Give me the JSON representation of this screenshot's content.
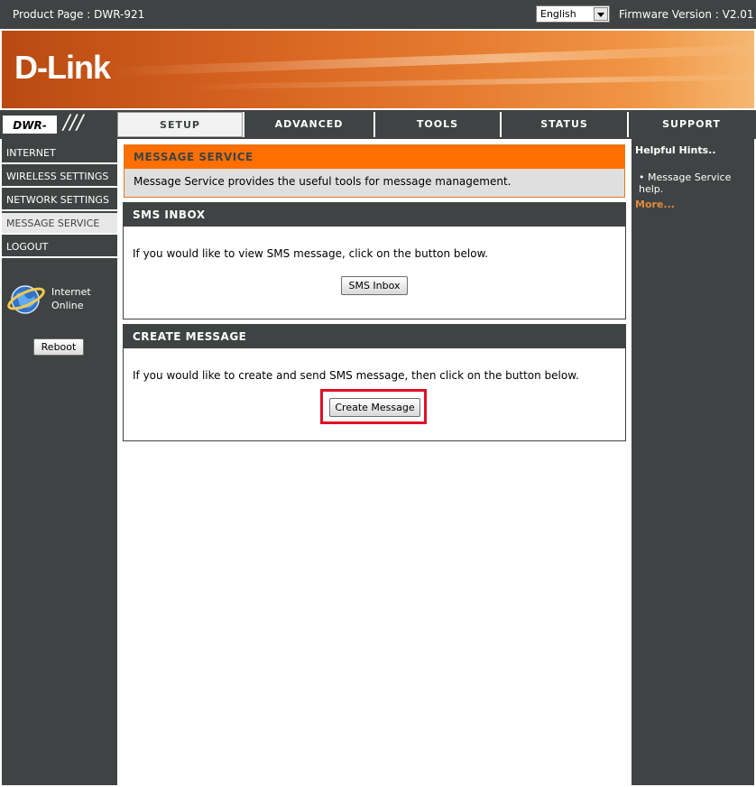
{
  "topbar": {
    "product_label": "Product Page :  DWR-921",
    "language": "English",
    "firmware_label": "Firmware Version : V2.01"
  },
  "brand": {
    "logo": "D-Link"
  },
  "model": {
    "name": "DWR-921"
  },
  "tabs": [
    {
      "label": "SETUP",
      "active": true
    },
    {
      "label": "ADVANCED",
      "active": false
    },
    {
      "label": "TOOLS",
      "active": false
    },
    {
      "label": "STATUS",
      "active": false
    },
    {
      "label": "SUPPORT",
      "active": false
    }
  ],
  "sidebar": {
    "items": [
      {
        "label": "INTERNET"
      },
      {
        "label": "WIRELESS SETTINGS"
      },
      {
        "label": "NETWORK SETTINGS"
      },
      {
        "label": "MESSAGE SERVICE",
        "active": true
      },
      {
        "label": "LOGOUT"
      }
    ],
    "status_line1": "Internet",
    "status_line2": "Online",
    "reboot_label": "Reboot"
  },
  "main": {
    "title": "MESSAGE SERVICE",
    "description": "Message Service provides the useful tools for message management.",
    "inbox": {
      "title": "SMS INBOX",
      "text": "If you would like to view SMS message, click on the button below.",
      "button": "SMS Inbox"
    },
    "create": {
      "title": "CREATE MESSAGE",
      "text": "If you would like to create and send SMS message, then click on the button below.",
      "button": "Create Message"
    }
  },
  "hints": {
    "title": "Helpful Hints..",
    "items": [
      "Message Service help."
    ],
    "more": "More..."
  },
  "colors": {
    "dark": "#404343",
    "orange": "#ff6f00",
    "highlight": "#e0102a",
    "more_link": "#e08a3c"
  }
}
